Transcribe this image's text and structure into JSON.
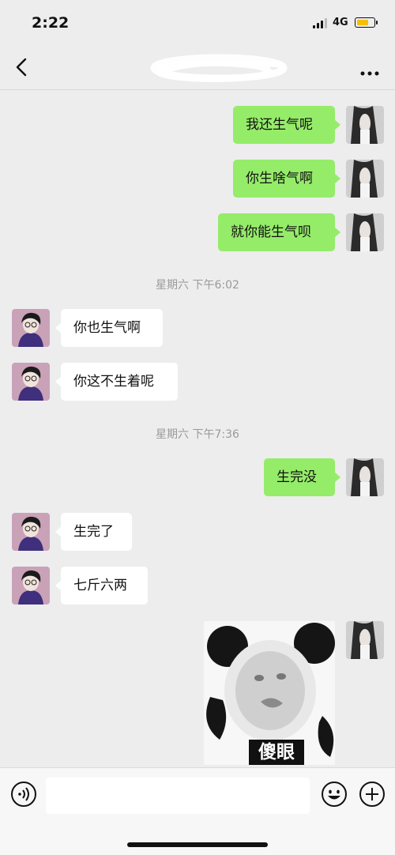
{
  "status_bar": {
    "time": "2:22",
    "network": "4G",
    "battery_color": "#f5c000"
  },
  "header": {
    "back_icon": "chevron-left-icon",
    "more_icon": "more-dots-icon",
    "title_scribbled": true
  },
  "colors": {
    "my_bubble": "#95ec69",
    "their_bubble": "#ffffff",
    "background": "#ededed"
  },
  "messages": [
    {
      "from": "me",
      "text": "我还生气呢"
    },
    {
      "from": "me",
      "text": "你生啥气啊"
    },
    {
      "from": "me",
      "text": "就你能生气呗"
    },
    {
      "from": "other",
      "text": "你也生气啊"
    },
    {
      "from": "other",
      "text": "你这不生着呢"
    },
    {
      "from": "me",
      "text": "生完没"
    },
    {
      "from": "other",
      "text": "生完了"
    },
    {
      "from": "other",
      "text": "七斤六两"
    }
  ],
  "timestamps": [
    "星期六 下午6:02",
    "星期六 下午7:36"
  ],
  "sticker": {
    "caption": "傻眼",
    "icon": "panda-meme-sticker"
  },
  "input_bar": {
    "voice_icon": "voice-icon",
    "emoji_icon": "emoji-icon",
    "plus_icon": "plus-icon",
    "value": ""
  }
}
